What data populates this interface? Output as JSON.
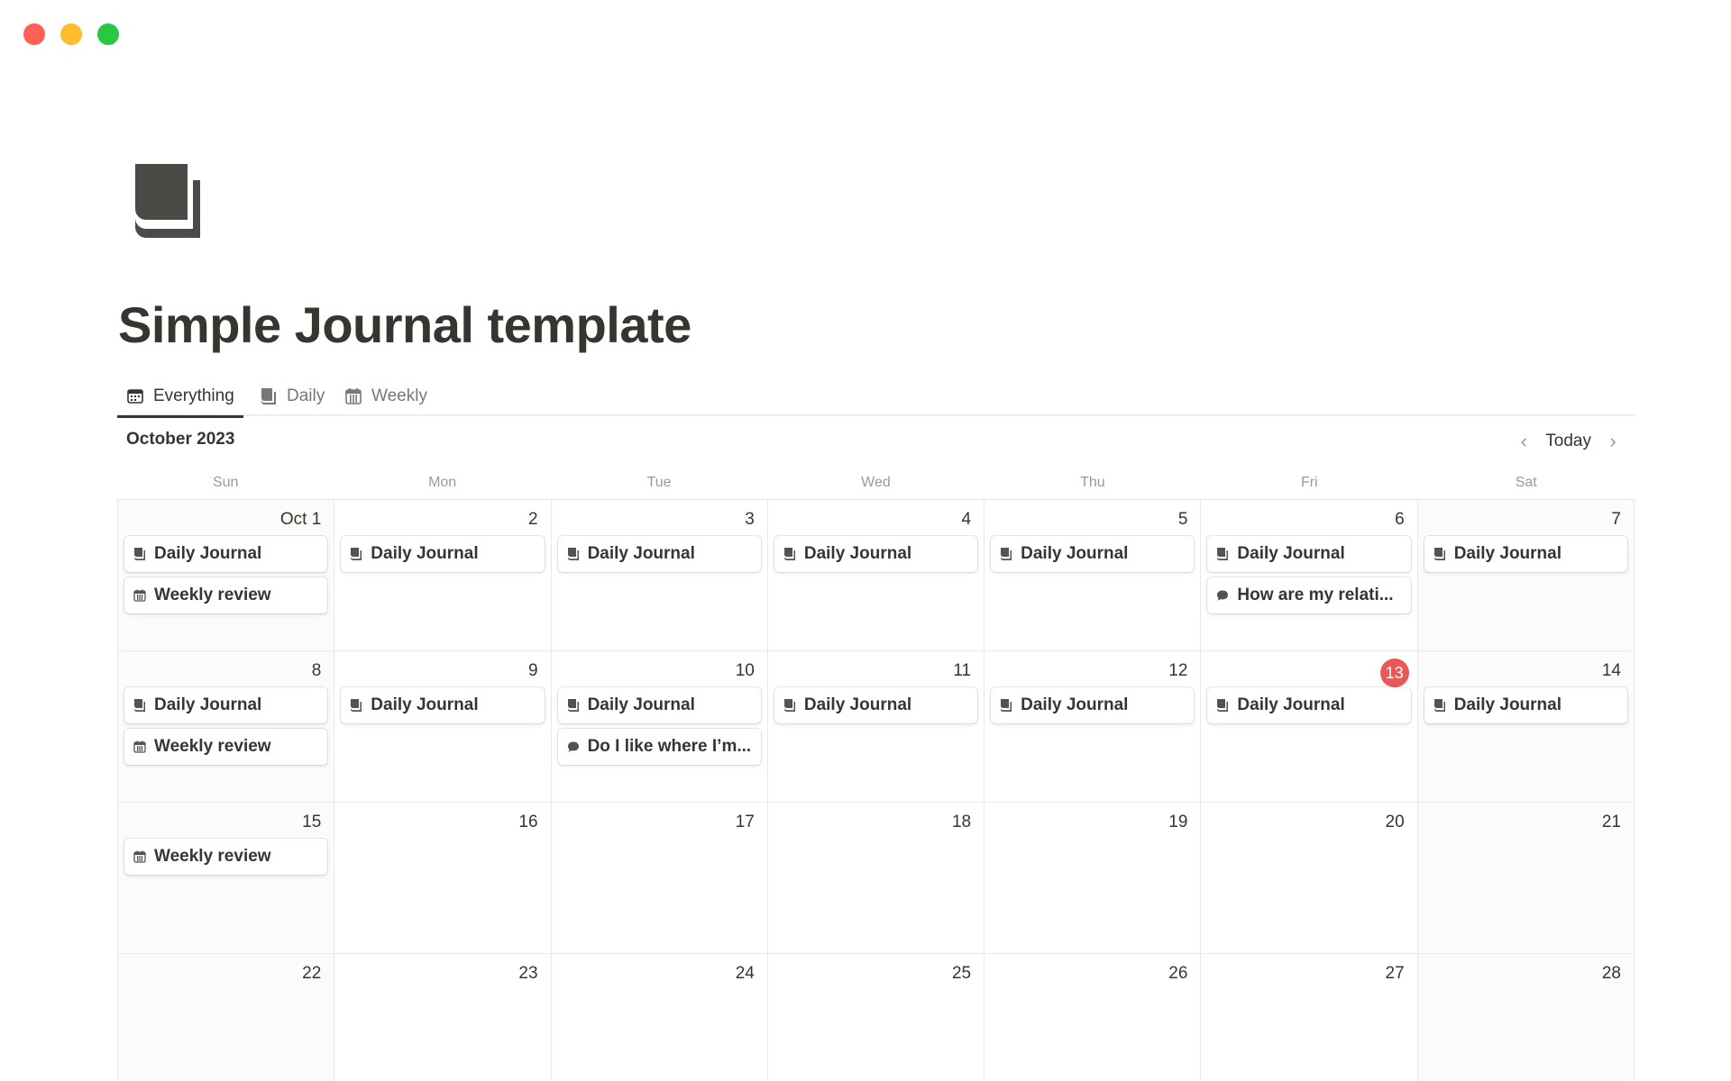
{
  "page": {
    "title": "Simple Journal template",
    "icon": "journal-book-icon"
  },
  "tabs": [
    {
      "label": "Everything",
      "icon": "calendar-view-icon",
      "active": true
    },
    {
      "label": "Daily",
      "icon": "journal-book-icon",
      "active": false
    },
    {
      "label": "Weekly",
      "icon": "calendar-grid-icon",
      "active": false
    }
  ],
  "calendar": {
    "month_label": "October 2023",
    "today_label": "Today",
    "prev_icon": "chevron-left-icon",
    "next_icon": "chevron-right-icon",
    "weekdays": [
      "Sun",
      "Mon",
      "Tue",
      "Wed",
      "Thu",
      "Fri",
      "Sat"
    ],
    "today_day": "13",
    "weeks": [
      [
        {
          "day": "Oct 1",
          "events": [
            {
              "label": "Daily Journal",
              "icon": "journal-book-icon"
            },
            {
              "label": "Weekly review",
              "icon": "calendar-grid-icon"
            }
          ]
        },
        {
          "day": "2",
          "events": [
            {
              "label": "Daily Journal",
              "icon": "journal-book-icon"
            }
          ]
        },
        {
          "day": "3",
          "events": [
            {
              "label": "Daily Journal",
              "icon": "journal-book-icon"
            }
          ]
        },
        {
          "day": "4",
          "events": [
            {
              "label": "Daily Journal",
              "icon": "journal-book-icon"
            }
          ]
        },
        {
          "day": "5",
          "events": [
            {
              "label": "Daily Journal",
              "icon": "journal-book-icon"
            }
          ]
        },
        {
          "day": "6",
          "events": [
            {
              "label": "Daily Journal",
              "icon": "journal-book-icon"
            },
            {
              "label": "How are my relati...",
              "icon": "speech-bubble-icon"
            }
          ]
        },
        {
          "day": "7",
          "events": [
            {
              "label": "Daily Journal",
              "icon": "journal-book-icon"
            }
          ]
        }
      ],
      [
        {
          "day": "8",
          "events": [
            {
              "label": "Daily Journal",
              "icon": "journal-book-icon"
            },
            {
              "label": "Weekly review",
              "icon": "calendar-grid-icon"
            }
          ]
        },
        {
          "day": "9",
          "events": [
            {
              "label": "Daily Journal",
              "icon": "journal-book-icon"
            }
          ]
        },
        {
          "day": "10",
          "events": [
            {
              "label": "Daily Journal",
              "icon": "journal-book-icon"
            },
            {
              "label": "Do I like where I’m...",
              "icon": "speech-bubble-icon"
            }
          ]
        },
        {
          "day": "11",
          "events": [
            {
              "label": "Daily Journal",
              "icon": "journal-book-icon"
            }
          ]
        },
        {
          "day": "12",
          "events": [
            {
              "label": "Daily Journal",
              "icon": "journal-book-icon"
            }
          ]
        },
        {
          "day": "13",
          "events": [
            {
              "label": "Daily Journal",
              "icon": "journal-book-icon"
            }
          ]
        },
        {
          "day": "14",
          "events": [
            {
              "label": "Daily Journal",
              "icon": "journal-book-icon"
            }
          ]
        }
      ],
      [
        {
          "day": "15",
          "events": [
            {
              "label": "Weekly review",
              "icon": "calendar-grid-icon"
            }
          ]
        },
        {
          "day": "16",
          "events": []
        },
        {
          "day": "17",
          "events": []
        },
        {
          "day": "18",
          "events": []
        },
        {
          "day": "19",
          "events": []
        },
        {
          "day": "20",
          "events": []
        },
        {
          "day": "21",
          "events": []
        }
      ],
      [
        {
          "day": "22",
          "events": []
        },
        {
          "day": "23",
          "events": []
        },
        {
          "day": "24",
          "events": []
        },
        {
          "day": "25",
          "events": []
        },
        {
          "day": "26",
          "events": []
        },
        {
          "day": "27",
          "events": []
        },
        {
          "day": "28",
          "events": []
        }
      ]
    ]
  },
  "colors": {
    "text": "#37352f",
    "muted": "#9b9a97",
    "today_badge": "#eb5757",
    "traffic_close": "#fe5f57",
    "traffic_minimize": "#febc2e",
    "traffic_maximize": "#28c840"
  }
}
